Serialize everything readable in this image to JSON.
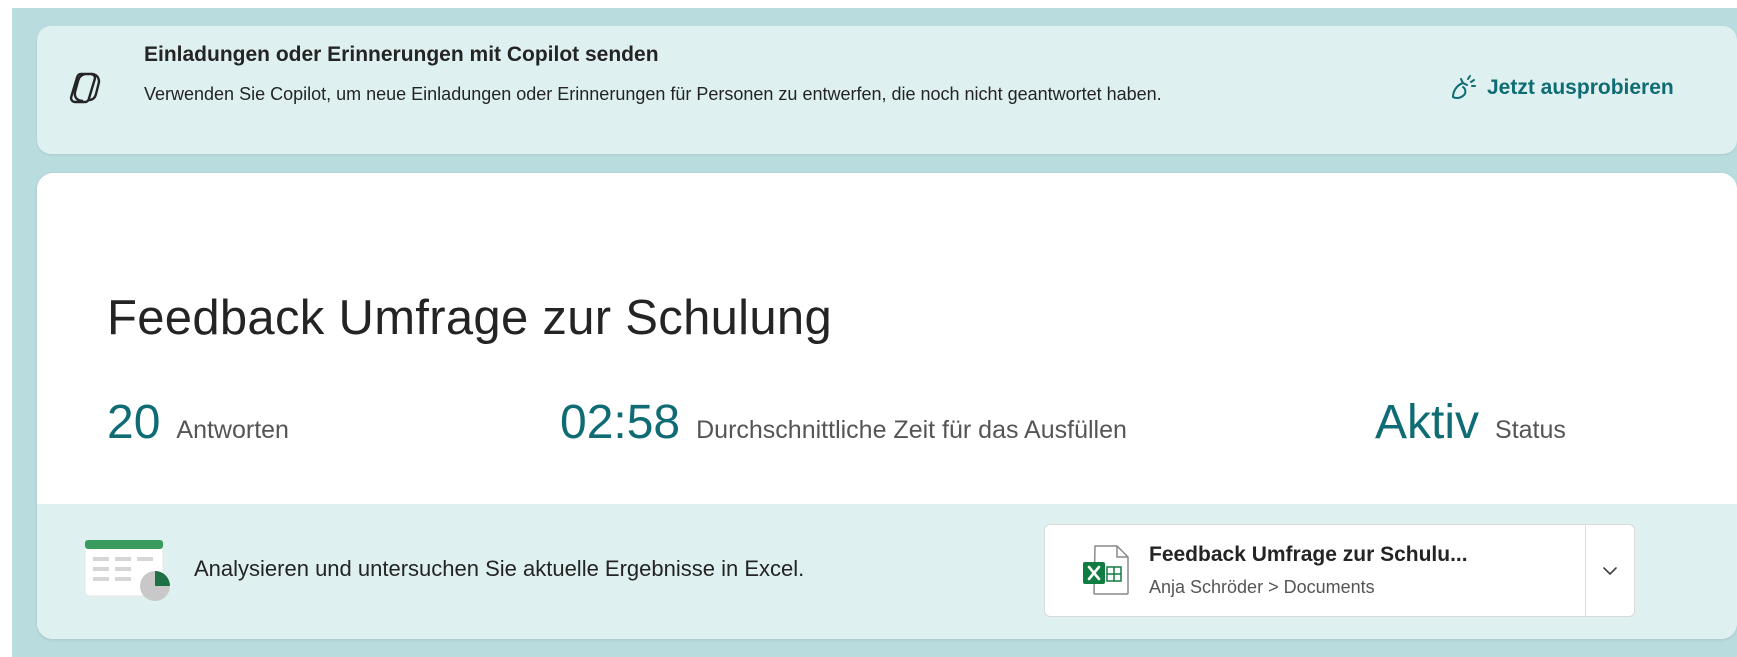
{
  "banner": {
    "title": "Einladungen oder Erinnerungen mit Copilot senden",
    "description": "Verwenden Sie Copilot, um neue Einladungen oder Erinnerungen für Personen zu entwerfen, die noch nicht geantwortet haben.",
    "try_label": "Jetzt ausprobieren",
    "icon": "copilot-icon",
    "try_icon": "copilot-spark-icon"
  },
  "form": {
    "title": "Feedback Umfrage zur Schulung",
    "stats": [
      {
        "value": "20",
        "label": "Antworten"
      },
      {
        "value": "02:58",
        "label": "Durchschnittliche Zeit für das Ausfüllen"
      },
      {
        "value": "Aktiv",
        "label": "Status"
      }
    ]
  },
  "excel": {
    "text": "Analysieren und untersuchen Sie aktuelle Ergebnisse in Excel.",
    "file_name": "Feedback Umfrage zur Schulu...",
    "file_path": "Anja Schröder > Documents",
    "icon": "excel-icon",
    "dropdown_icon": "chevron-down-icon"
  },
  "colors": {
    "accent": "#0f6c74",
    "page_background": "#b9dcdf",
    "banner_background": "#dff0f1",
    "excel_green": "#107c41"
  }
}
